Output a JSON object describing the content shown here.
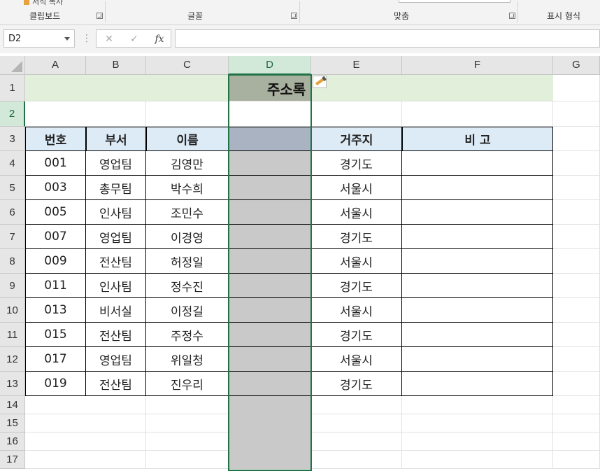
{
  "ribbon": {
    "partial_label": "서식 복사",
    "groups": [
      {
        "label": "클립보드"
      },
      {
        "label": "글꼴"
      },
      {
        "label": "맞춤"
      },
      {
        "label": "표시 형식"
      }
    ]
  },
  "formula_bar": {
    "name_box": "D2",
    "cancel_icon": "✕",
    "enter_icon": "✓",
    "fx_label": "fx",
    "formula": ""
  },
  "columns": [
    "A",
    "B",
    "C",
    "D",
    "E",
    "F",
    "G"
  ],
  "rows": [
    "1",
    "2",
    "3",
    "4",
    "5",
    "6",
    "7",
    "8",
    "9",
    "10",
    "11",
    "12",
    "13",
    "14",
    "15",
    "16",
    "17"
  ],
  "sheet": {
    "title": "주소록",
    "headers": {
      "a": "번호",
      "b": "부서",
      "c": "이름",
      "d": "",
      "e": "거주지",
      "f": "비  고"
    },
    "records": [
      {
        "no": "001",
        "dept": "영업팀",
        "name": "김영만",
        "addr": "경기도"
      },
      {
        "no": "003",
        "dept": "총무팀",
        "name": "박수희",
        "addr": "서울시"
      },
      {
        "no": "005",
        "dept": "인사팀",
        "name": "조민수",
        "addr": "서울시"
      },
      {
        "no": "007",
        "dept": "영업팀",
        "name": "이경영",
        "addr": "경기도"
      },
      {
        "no": "009",
        "dept": "전산팀",
        "name": "허정일",
        "addr": "서울시"
      },
      {
        "no": "011",
        "dept": "인사팀",
        "name": "정수진",
        "addr": "경기도"
      },
      {
        "no": "013",
        "dept": "비서실",
        "name": "이정길",
        "addr": "서울시"
      },
      {
        "no": "015",
        "dept": "전산팀",
        "name": "주정수",
        "addr": "경기도"
      },
      {
        "no": "017",
        "dept": "영업팀",
        "name": "위일청",
        "addr": "서울시"
      },
      {
        "no": "019",
        "dept": "전산팀",
        "name": "진우리",
        "addr": "경기도"
      }
    ]
  },
  "colors": {
    "accent": "#217346",
    "title_fill": "#e2efda",
    "header_fill": "#ddebf7",
    "selection_fill": "#c9c9c9"
  },
  "icons": {
    "paste_options": "paintbrush-icon",
    "launcher": "dialog-launcher-icon"
  }
}
